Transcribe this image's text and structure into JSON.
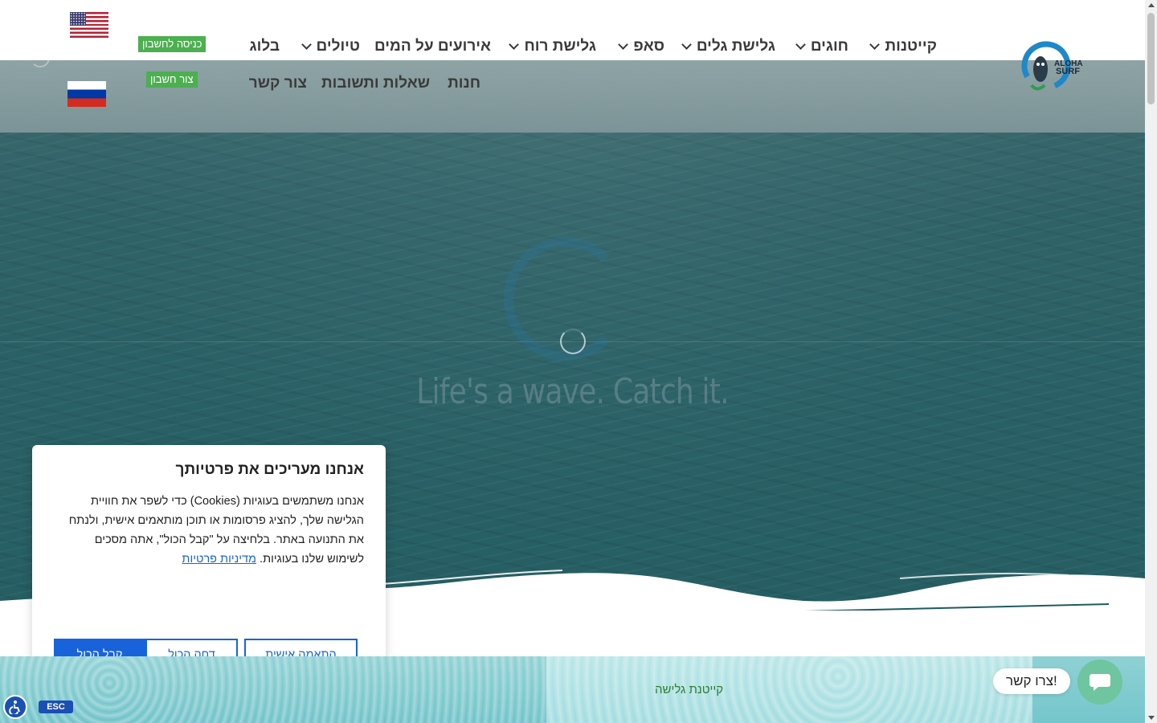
{
  "brand": {
    "logo_text": "ALOHA SURF",
    "accent_color": "#1e88c9"
  },
  "header": {
    "nav_row1": [
      {
        "label": "קייטנות",
        "has_dropdown": true
      },
      {
        "label": "חוגים",
        "has_dropdown": true
      },
      {
        "label": "גלישת גלים",
        "has_dropdown": true
      },
      {
        "label": "סאפ",
        "has_dropdown": true
      },
      {
        "label": "גלישת רוח",
        "has_dropdown": true
      },
      {
        "label": "אירועים על המים",
        "has_dropdown": false
      },
      {
        "label": "טיולים",
        "has_dropdown": true
      },
      {
        "label": "בלוג",
        "has_dropdown": false
      }
    ],
    "nav_row2": [
      {
        "label": "חנות"
      },
      {
        "label": "שאלות ותשובות"
      },
      {
        "label": "צור קשר"
      }
    ],
    "login_label": "כניסה לחשבון",
    "register_label": "צור חשבון",
    "languages": [
      "us-flag-icon",
      "ru-flag-icon"
    ],
    "button_color": "#4caf50"
  },
  "hero": {
    "tagline": "Life's a wave. Catch it."
  },
  "cookie_banner": {
    "title": "אנחנו מעריכים את פרטיותך",
    "text": "אנחנו משתמשים בעוגיות (Cookies) כדי לשפר את חוויית הגלישה שלך, להציג פרסומות או תוכן מותאמים אישית, ולנתח את התנועה באתר. בלחיצה על \"קבל הכול\", אתה מסכים לשימוש שלנו בעוגיות.",
    "privacy_link": "מדיניות פרטיות",
    "customize_label": "התאמה אישית",
    "reject_label": "דחה הכול",
    "accept_label": "קבל הכול",
    "accent_color": "#1863dc"
  },
  "bottom": {
    "camp_label": "קייטנת גלישה"
  },
  "contact": {
    "label": "צרו קשר!",
    "color": "#6ec5a0"
  },
  "accessibility": {
    "esc_label": "ESC"
  }
}
